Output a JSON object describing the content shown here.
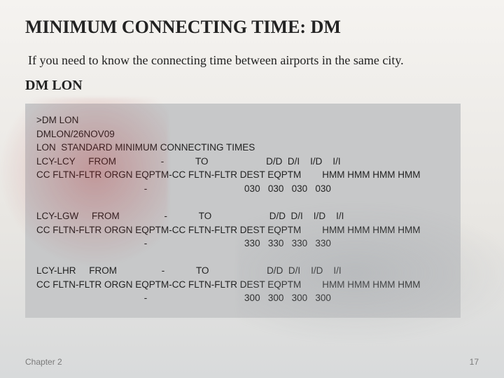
{
  "title": "MINIMUM CONNECTING TIME: DM",
  "lead": "If you need to know the connecting time between airports in the same city.",
  "command_label": "DM LON",
  "terminal_lines": [
    ">DM LON",
    "DMLON/26NOV09",
    "LON  STANDARD MINIMUM CONNECTING TIMES",
    "LCY-LCY     FROM                 -            TO                      D/D  D/I    I/D    I/I",
    "CC FLTN-FLTR ORGN EQPTM-CC FLTN-FLTR DEST EQPTM        HMM HMM HMM HMM",
    "                                         -                                     030   030   030   030",
    "",
    "LCY-LGW     FROM                 -            TO                      D/D  D/I    I/D    I/I",
    "CC FLTN-FLTR ORGN EQPTM-CC FLTN-FLTR DEST EQPTM        HMM HMM HMM HMM",
    "                                         -                                     330   330   330   330",
    "",
    "LCY-LHR     FROM                 -            TO                      D/D  D/I    I/D    I/I",
    "CC FLTN-FLTR ORGN EQPTM-CC FLTN-FLTR DEST EQPTM        HMM HMM HMM HMM",
    "                                         -                                     300   300   300   300"
  ],
  "footer": {
    "chapter": "Chapter 2",
    "page": "17"
  }
}
